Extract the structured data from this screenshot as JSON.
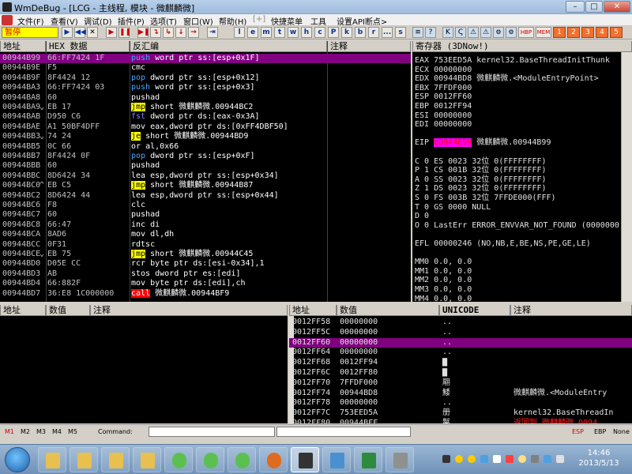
{
  "window": {
    "title": "WmDeBug - [LCG - 主线程, 模块 - 微麒麟微]",
    "buttons": [
      "–",
      "□",
      "✕"
    ]
  },
  "menu": [
    "文件(F)",
    "查看(V)",
    "调试(D)",
    "插件(P)",
    "选项(T)",
    "窗口(W)",
    "帮助(H)",
    "[+]",
    "快捷菜单",
    "工具",
    "设置API断点>"
  ],
  "toolbar": {
    "status": "暂停",
    "buttons": [
      "▶",
      "◀◀",
      "✕",
      "▶",
      "❚❚",
      "▶❚",
      "↴",
      "↳",
      "↓",
      "→",
      "⇥"
    ],
    "letters": [
      "l",
      "e",
      "m",
      "t",
      "w",
      "h",
      "c",
      "P",
      "k",
      "b",
      "r",
      "...",
      "s"
    ],
    "right_icons": [
      "≡",
      "?",
      "K",
      "Ҁ",
      "⚠",
      "⚠",
      "⚙",
      "⚙",
      "HBP",
      "MEM"
    ],
    "numbers": [
      "1",
      "2",
      "3",
      "4",
      "5"
    ]
  },
  "disasm": {
    "headers": {
      "addr": "地址",
      "hex": "HEX 数据",
      "dis": "反汇编",
      "cmt": "注释"
    },
    "rows": [
      {
        "addr": "00944B99",
        "hex": "66:FF7424 1F",
        "pre": "",
        "op": "push",
        "rest": " word ptr ss:[esp+0x1F]",
        "cls": "op-blue",
        "sel": true
      },
      {
        "addr": "00944B9E",
        "hex": "F5",
        "pre": "",
        "op": "cmc",
        "rest": "",
        "cls": ""
      },
      {
        "addr": "00944B9F",
        "hex": "8F4424 12",
        "pre": "",
        "op": "pop",
        "rest": " dword ptr ss:[esp+0x12]",
        "cls": "op-blue"
      },
      {
        "addr": "00944BA3",
        "hex": "66:FF7424 03",
        "pre": "",
        "op": "push",
        "rest": " word ptr ss:[esp+0x3]",
        "cls": "op-blue"
      },
      {
        "addr": "00944BA8",
        "hex": "60",
        "pre": "",
        "op": "pushad",
        "rest": "",
        "cls": ""
      },
      {
        "addr": "00944BA9",
        "hex": "EB 17",
        "pre": "⌄",
        "op": "jmp",
        "rest": " short 微麒麟微.00944BC2",
        "cls": "op-hi"
      },
      {
        "addr": "00944BAB",
        "hex": "D950 C6",
        "pre": "",
        "op": "fst",
        "rest": " dword ptr ds:[eax-0x3A]",
        "cls": "op-dim"
      },
      {
        "addr": "00944BAE",
        "hex": "A1 50BF4DFF",
        "pre": "",
        "op": "mov",
        "rest": " eax,dword ptr ds:[0xFF4DBF50]",
        "cls": ""
      },
      {
        "addr": "00944BB3",
        "hex": "74 24",
        "pre": "⌄",
        "op": "je",
        "rest": " short 微麒麟微.00944BD9",
        "cls": "op-hi"
      },
      {
        "addr": "00944BB5",
        "hex": "0C 66",
        "pre": "",
        "op": "or",
        "rest": " al,0x66",
        "cls": ""
      },
      {
        "addr": "00944BB7",
        "hex": "8F4424 0F",
        "pre": "",
        "op": "pop",
        "rest": " dword ptr ss:[esp+0xF]",
        "cls": "op-blue"
      },
      {
        "addr": "00944BBB",
        "hex": "60",
        "pre": "",
        "op": "pushad",
        "rest": "",
        "cls": ""
      },
      {
        "addr": "00944BBC",
        "hex": "8D6424 34",
        "pre": "",
        "op": "lea",
        "rest": " esp,dword ptr ss:[esp+0x34]",
        "cls": ""
      },
      {
        "addr": "00944BC0",
        "hex": "EB C5",
        "pre": "^",
        "op": "jmp",
        "rest": " short 微麒麟微.00944B87",
        "cls": "op-hi"
      },
      {
        "addr": "00944BC2",
        "hex": "8D6424 44",
        "pre": "",
        "op": "lea",
        "rest": " esp,dword ptr ss:[esp+0x44]",
        "cls": ""
      },
      {
        "addr": "00944BC6",
        "hex": "F8",
        "pre": "",
        "op": "clc",
        "rest": "",
        "cls": ""
      },
      {
        "addr": "00944BC7",
        "hex": "60",
        "pre": "",
        "op": "pushad",
        "rest": "",
        "cls": ""
      },
      {
        "addr": "00944BC8",
        "hex": "66:47",
        "pre": "",
        "op": "inc",
        "rest": " di",
        "cls": ""
      },
      {
        "addr": "00944BCA",
        "hex": "8AD6",
        "pre": "",
        "op": "mov",
        "rest": " dl,dh",
        "cls": ""
      },
      {
        "addr": "00944BCC",
        "hex": "0F31",
        "pre": "",
        "op": "rdtsc",
        "rest": "",
        "cls": ""
      },
      {
        "addr": "00944BCE",
        "hex": "EB 75",
        "pre": "⌄",
        "op": "jmp",
        "rest": " short 微麒麟微.00944C45",
        "cls": "op-hi"
      },
      {
        "addr": "00944BD0",
        "hex": "D05E CC",
        "pre": "",
        "op": "rcr",
        "rest": " byte ptr ds:[esi-0x34],1",
        "cls": ""
      },
      {
        "addr": "00944BD3",
        "hex": "AB",
        "pre": "",
        "op": "stos",
        "rest": " dword ptr es:[edi]",
        "cls": ""
      },
      {
        "addr": "00944BD4",
        "hex": "66:882F",
        "pre": "",
        "op": "mov",
        "rest": " byte ptr ds:[edi],ch",
        "cls": ""
      },
      {
        "addr": "00944BD7",
        "hex": "36:E8 1C000000",
        "pre": "",
        "op": "call",
        "rest": " 微麒麟微.00944BF9",
        "cls": "op-red"
      }
    ]
  },
  "registers": {
    "header": "寄存器 (3DNow!)",
    "lines": [
      "EAX 753EED5A kernel32.BaseThreadInitThunk",
      "ECX 00000000",
      "EDX 00944BD8 微麒麟微.<ModuleEntryPoint>",
      "EBX 7FFDF000",
      "ESP 0012FF60",
      "EBP 0012FF94",
      "ESI 00000000",
      "EDI 00000000",
      "",
      "EIP |00944B99| 微麒麟微.00944B99",
      "",
      "C 0   ES 0023 32位 0(FFFFFFFF)",
      "P 1   CS 001B 32位 0(FFFFFFFF)",
      "A 0   SS 0023 32位 0(FFFFFFFF)",
      "Z 1   DS 0023 32位 0(FFFFFFFF)",
      "S 0   FS 003B 32位 7FFDE000(FFF)",
      "T 0   GS 0000 NULL",
      "D 0",
      "O 0   LastErr ERROR_ENVVAR_NOT_FOUND (0000000",
      "",
      "EFL 00000246 (NO,NB,E,BE,NS,PE,GE,LE)",
      "",
      "MM0          0.0,          0.0",
      "MM1          0.0,          0.0",
      "MM2          0.0,          0.0",
      "MM3          0.0,          0.0",
      "MM4          0.0,          0.0"
    ]
  },
  "dump": {
    "headers": {
      "addr": "地址",
      "val": "数值",
      "cmt": "注释"
    }
  },
  "stack": {
    "headers": {
      "addr": "地址",
      "val": "数值",
      "uni": "UNICODE",
      "cmt": "注释"
    },
    "rows": [
      {
        "addr": "0012FF58",
        "val": "00000000",
        "uni": "..",
        "cmt": ""
      },
      {
        "addr": "0012FF5C",
        "val": "00000000",
        "uni": "..",
        "cmt": ""
      },
      {
        "addr": "0012FF60",
        "val": "00000000",
        "uni": "..",
        "cmt": "",
        "sel": true
      },
      {
        "addr": "0012FF64",
        "val": "00000000",
        "uni": "..",
        "cmt": ""
      },
      {
        "addr": "0012FF68",
        "val": "0012FF94",
        "uni": "▇",
        "cmt": ""
      },
      {
        "addr": "0012FF6C",
        "val": "0012FF80",
        "uni": "▇",
        "cmt": ""
      },
      {
        "addr": "0012FF70",
        "val": "7FFDF000",
        "uni": "  翢",
        "cmt": ""
      },
      {
        "addr": "0012FF74",
        "val": "00944BD8",
        "uni": "鯘",
        "cmt": "微麒麟微.<ModuleEntry"
      },
      {
        "addr": "0012FF78",
        "val": "00000000",
        "uni": "..",
        "cmt": ""
      },
      {
        "addr": "0012FF7C",
        "val": "753EED5A",
        "uni": "  册",
        "cmt": "kernel32.BaseThreadIn"
      },
      {
        "addr": "0012FF80",
        "val": "00944BFF",
        "uni": "鬣",
        "cmt": "返回到 微麒麟微.0094",
        "red": true
      }
    ]
  },
  "cmdbar": {
    "marks": [
      "M1",
      "M2",
      "M3",
      "M4",
      "M5"
    ],
    "command_label": "Command:",
    "command_value": "",
    "right": [
      "ESP",
      "EBP",
      "None"
    ]
  },
  "taskbar": {
    "time": "14:46",
    "date": "2013/5/13"
  }
}
